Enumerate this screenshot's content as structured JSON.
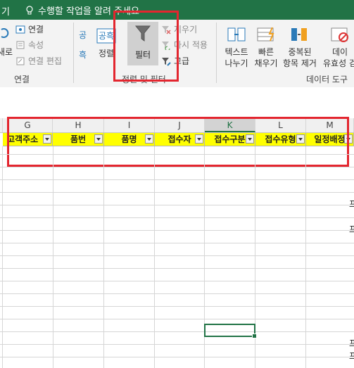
{
  "titlebar": {
    "tab_fragment": "기",
    "tell_me": "수행할 작업을 알려 주세요"
  },
  "ribbon": {
    "connections_group": {
      "refresh_fragment": "새로",
      "connections": "연결",
      "properties": "속성",
      "edit_links": "연결 편집",
      "label": "연결"
    },
    "sort_filter_group": {
      "sort_fragment": "정렬",
      "filter": "필터",
      "clear": "지우기",
      "reapply": "다시 적용",
      "advanced": "고급",
      "label": "정렬 및 필터"
    },
    "data_tools_group": {
      "text_to_columns": [
        "텍스트",
        "나누기"
      ],
      "flash_fill": [
        "빠른",
        "채우기"
      ],
      "remove_duplicates": [
        "중복된",
        "항목 제거"
      ],
      "data_validation": [
        "데이",
        "유효성 검"
      ],
      "label": "데이터 도구"
    }
  },
  "columns": [
    {
      "letter": "G",
      "selected": false
    },
    {
      "letter": "H",
      "selected": false
    },
    {
      "letter": "I",
      "selected": false
    },
    {
      "letter": "J",
      "selected": false
    },
    {
      "letter": "K",
      "selected": true
    },
    {
      "letter": "L",
      "selected": false
    },
    {
      "letter": "M",
      "selected": false
    }
  ],
  "header_row": [
    "고객주소",
    "품번",
    "품명",
    "접수자",
    "접수구분",
    "접수유형",
    "일정배정"
  ],
  "edge_chars": [
    "프",
    "프",
    "프",
    "프"
  ],
  "colors": {
    "excel_green": "#217346",
    "header_fill": "#ffff00",
    "highlight_red": "#e3262f"
  }
}
